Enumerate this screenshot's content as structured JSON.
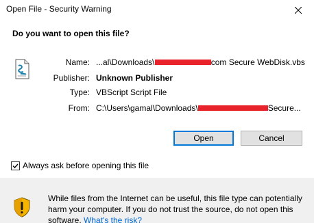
{
  "window": {
    "title": "Open File - Security Warning"
  },
  "dialog": {
    "question": "Do you want to open this file?"
  },
  "file_info": {
    "name_label": "Name:",
    "name_prefix": "...al\\Downloads\\",
    "name_suffix": ".com Secure WebDisk.vbs",
    "publisher_label": "Publisher:",
    "publisher_value": "Unknown Publisher",
    "type_label": "Type:",
    "type_value": "VBScript Script File",
    "from_label": "From:",
    "from_prefix": "C:\\Users\\gamal\\Downloads\\",
    "from_suffix": "Secure..."
  },
  "buttons": {
    "open_label": "Open",
    "cancel_label": "Cancel"
  },
  "options": {
    "always_ask_label": "Always ask before opening this file",
    "always_ask_checked": true
  },
  "warning": {
    "text": "While files from the Internet can be useful, this file type can potentially harm your computer. If you do not trust the source, do not open this software. ",
    "link_text": "What's the risk?"
  },
  "colors": {
    "redaction": "#e8232c",
    "accent": "#0078d7",
    "link": "#0066cc"
  }
}
